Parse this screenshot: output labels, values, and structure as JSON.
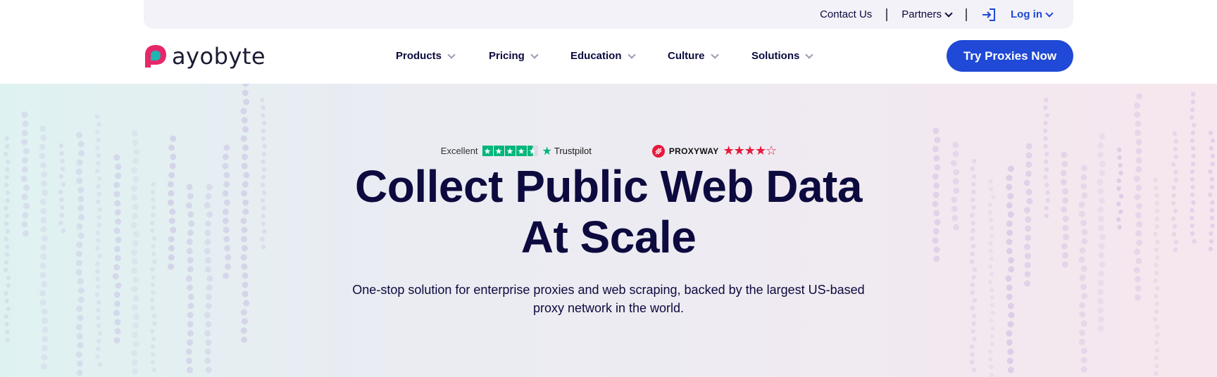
{
  "utility_bar": {
    "contact_label": "Contact Us",
    "partners_label": "Partners",
    "login_label": "Log in"
  },
  "nav": {
    "logo_text": "ayobyte",
    "items": [
      {
        "label": "Products"
      },
      {
        "label": "Pricing"
      },
      {
        "label": "Education"
      },
      {
        "label": "Culture"
      },
      {
        "label": "Solutions"
      }
    ],
    "cta_label": "Try Proxies Now"
  },
  "hero": {
    "trustpilot": {
      "rating_word": "Excellent",
      "brand": "Trustpilot",
      "stars": 4.5
    },
    "proxyway": {
      "brand": "PROXYWAY",
      "stars": 4
    },
    "headline_line1": "Collect Public Web Data",
    "headline_line2": "At Scale",
    "subhead_line1": "One-stop solution for enterprise proxies and web scraping, backed by the largest US-based",
    "subhead_line2": "proxy network in the world."
  },
  "colors": {
    "brand_blue": "#1f49d6",
    "text_navy": "#0c0a3e",
    "trustpilot_green": "#00b67a",
    "proxyway_red": "#e8193c",
    "logo_pink": "#e6276a",
    "logo_teal": "#1fb5b0"
  },
  "icons": [
    "logo-mark",
    "login-icon",
    "chevron-down-icon",
    "trustpilot-star-icon",
    "proxyway-logo-icon",
    "star-icon"
  ]
}
